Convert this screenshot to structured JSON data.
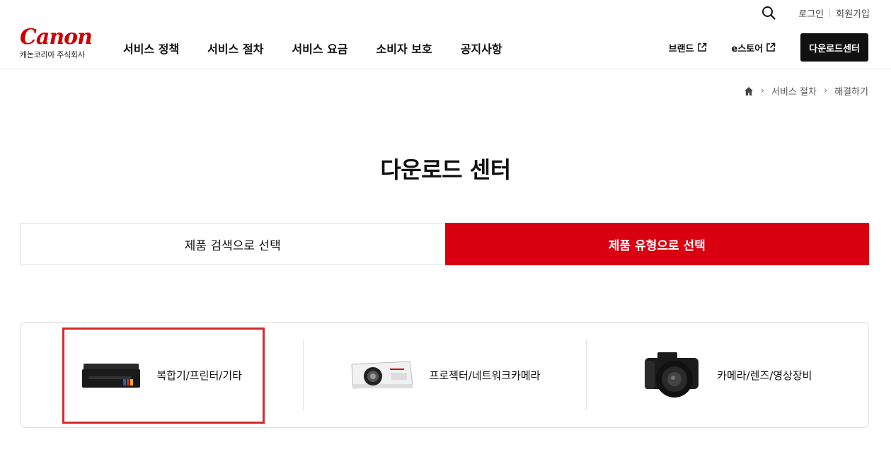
{
  "utility": {
    "login": "로그인",
    "signup": "회원가입"
  },
  "logo": {
    "brand": "Canon",
    "corp": "캐논코리아 주식회사"
  },
  "gnb": [
    "서비스 정책",
    "서비스 절차",
    "서비스 요금",
    "소비자 보호",
    "공지사항"
  ],
  "header_right": {
    "brand": "브랜드",
    "estore": "e스토어",
    "download_center": "다운로드센터"
  },
  "breadcrumb": {
    "level1": "서비스 절차",
    "level2": "해결하기"
  },
  "page_title": "다운로드 센터",
  "tabs": {
    "search": "제품 검색으로 선택",
    "type": "제품 유형으로 선택"
  },
  "categories": [
    {
      "label": "복합기/프린터/기타",
      "icon": "printer-image"
    },
    {
      "label": "프로젝터/네트워크카메라",
      "icon": "projector-image"
    },
    {
      "label": "카메라/렌즈/영상장비",
      "icon": "camera-image"
    }
  ],
  "colors": {
    "brand_red": "#cc0000",
    "active_tab": "#d80011",
    "highlight": "#d62b2b",
    "button_dark": "#111111"
  }
}
